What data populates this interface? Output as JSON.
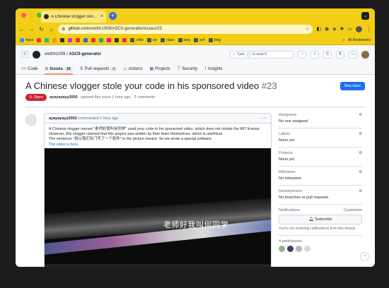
{
  "browser": {
    "tab_title": "A Chinese vlogger stole your code",
    "tab_close": "×",
    "new_tab": "+",
    "tab_overflow": "⌄",
    "url_host": "github.com",
    "url_path": "/viethh1009/ASCII-generator/issues/23",
    "bookmarks": [
      {
        "label": "Apps",
        "color": "#4a8af4"
      },
      {
        "label": "",
        "color": "#e33"
      },
      {
        "label": "",
        "color": "#2b8"
      },
      {
        "label": "",
        "color": "#f80"
      },
      {
        "label": "",
        "color": "#333"
      },
      {
        "label": "",
        "color": "#c3c"
      },
      {
        "label": "",
        "color": "#e33"
      },
      {
        "label": "",
        "color": "#36c"
      },
      {
        "label": "",
        "color": "#e33"
      },
      {
        "label": "",
        "color": "#2a7"
      },
      {
        "label": "",
        "color": "#f0a"
      },
      {
        "label": "",
        "color": "#333"
      },
      {
        "label": "",
        "color": "#e33"
      },
      {
        "label": "chibi",
        "color": "#555"
      },
      {
        "label": "cie",
        "color": "#555"
      },
      {
        "label": "class",
        "color": "#555"
      },
      {
        "label": "lang",
        "color": "#555"
      },
      {
        "label": "sch",
        "color": "#555"
      },
      {
        "label": "blog",
        "color": "#555"
      }
    ],
    "bookmarks_more": "»",
    "all_bookmarks": "All Bookmarks"
  },
  "github": {
    "owner": "viethh1009",
    "repo": "ASCII-generator",
    "search_placeholder": "Type",
    "search_kbd": "/",
    "search_suffix": "to search",
    "tabs": [
      {
        "label": "Code",
        "icon": "<>",
        "count": ""
      },
      {
        "label": "Issues",
        "icon": "⊙",
        "count": "16"
      },
      {
        "label": "Pull requests",
        "icon": "⇅",
        "count": "4"
      },
      {
        "label": "Actions",
        "icon": "▷",
        "count": ""
      },
      {
        "label": "Projects",
        "icon": "▦",
        "count": ""
      },
      {
        "label": "Security",
        "icon": "⛉",
        "count": ""
      },
      {
        "label": "Insights",
        "icon": "⌇",
        "count": ""
      }
    ]
  },
  "issue": {
    "title": "A Chinese vlogger stole your code in his sponsored video",
    "number": "#23",
    "new_issue_label": "New issue",
    "state": "Open",
    "author": "ayayayayy2002",
    "opened_text": "opened this issue 1 hour ago · 3 comments",
    "comment": {
      "author": "ayayayayy2002",
      "meta": "commented 1 hour ago",
      "more": "···",
      "line1": "A Chinese vlogger named \"老师好我叫何同学\" used your code in his sponsored video, which does not violate the MIT license.",
      "line2": "However, this vlogger claimed that this project was written by their team themselves, which is unethical.",
      "line3": "The sentence \"用以我们专门写了一个软件\" in the picture means: So we wrote a special software",
      "link": "The video is here",
      "video_subtitle": "老师好我叫何同学"
    }
  },
  "sidebar": {
    "assignees_title": "Assignees",
    "assignees_value": "No one assigned",
    "labels_title": "Labels",
    "labels_value": "None yet",
    "projects_title": "Projects",
    "projects_value": "None yet",
    "milestone_title": "Milestone",
    "milestone_value": "No milestone",
    "development_title": "Development",
    "development_value": "No branches or pull requests",
    "notifications_title": "Notifications",
    "customize": "Customize",
    "subscribe": "Subscribe",
    "notif_note": "You're not receiving notifications from this thread.",
    "participants_title": "4 participants"
  }
}
